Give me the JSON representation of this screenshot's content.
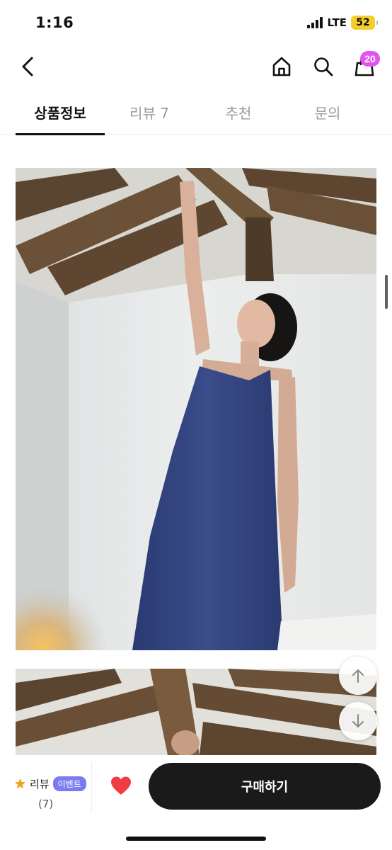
{
  "status_bar": {
    "time": "1:16",
    "network": "LTE",
    "battery": "52",
    "battery_color": "#f4cf2a"
  },
  "navbar": {
    "icons": [
      "chevron-left-icon",
      "home-icon",
      "search-icon",
      "shopping-bag-icon"
    ],
    "cart_count": "20",
    "cart_badge_color": "#e254ee"
  },
  "tabs": [
    {
      "label": "상품정보",
      "active": true
    },
    {
      "label": "리뷰 7",
      "active": false
    },
    {
      "label": "추천",
      "active": false
    },
    {
      "label": "문의",
      "active": false
    }
  ],
  "gallery": {
    "photo_1": "product-photo-blue-slip-dress",
    "photo_2": "product-photo-wooden-ceiling-beams"
  },
  "float_buttons": {
    "up_icon": "arrow-up-icon",
    "down_icon": "arrow-down-icon"
  },
  "bottom_bar": {
    "review_label": "리뷰",
    "event_badge": "이벤트",
    "review_count": "(7)",
    "buy_label": "구매하기",
    "star_color": "#f2a21b",
    "heart_color": "#ef3c44",
    "event_badge_color": "#7b7cf0"
  }
}
